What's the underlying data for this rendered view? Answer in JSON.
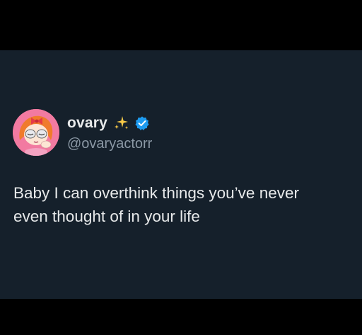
{
  "tweet": {
    "display_name": "ovary",
    "emoji_icon": "sparkles-icon",
    "verified_icon": "verified-badge-icon",
    "handle": "@ovaryactorr",
    "text": "Baby I can overthink things you’ve never\neven thought of in your life"
  },
  "colors": {
    "background": "#15202b",
    "letterbox": "#000000",
    "primary_text": "#e7e9ea",
    "secondary_text": "#8b98a5",
    "verified_blue": "#1d9bf0",
    "avatar_pink": "#f27aa1",
    "sparkle_gold": "#f7c948"
  }
}
